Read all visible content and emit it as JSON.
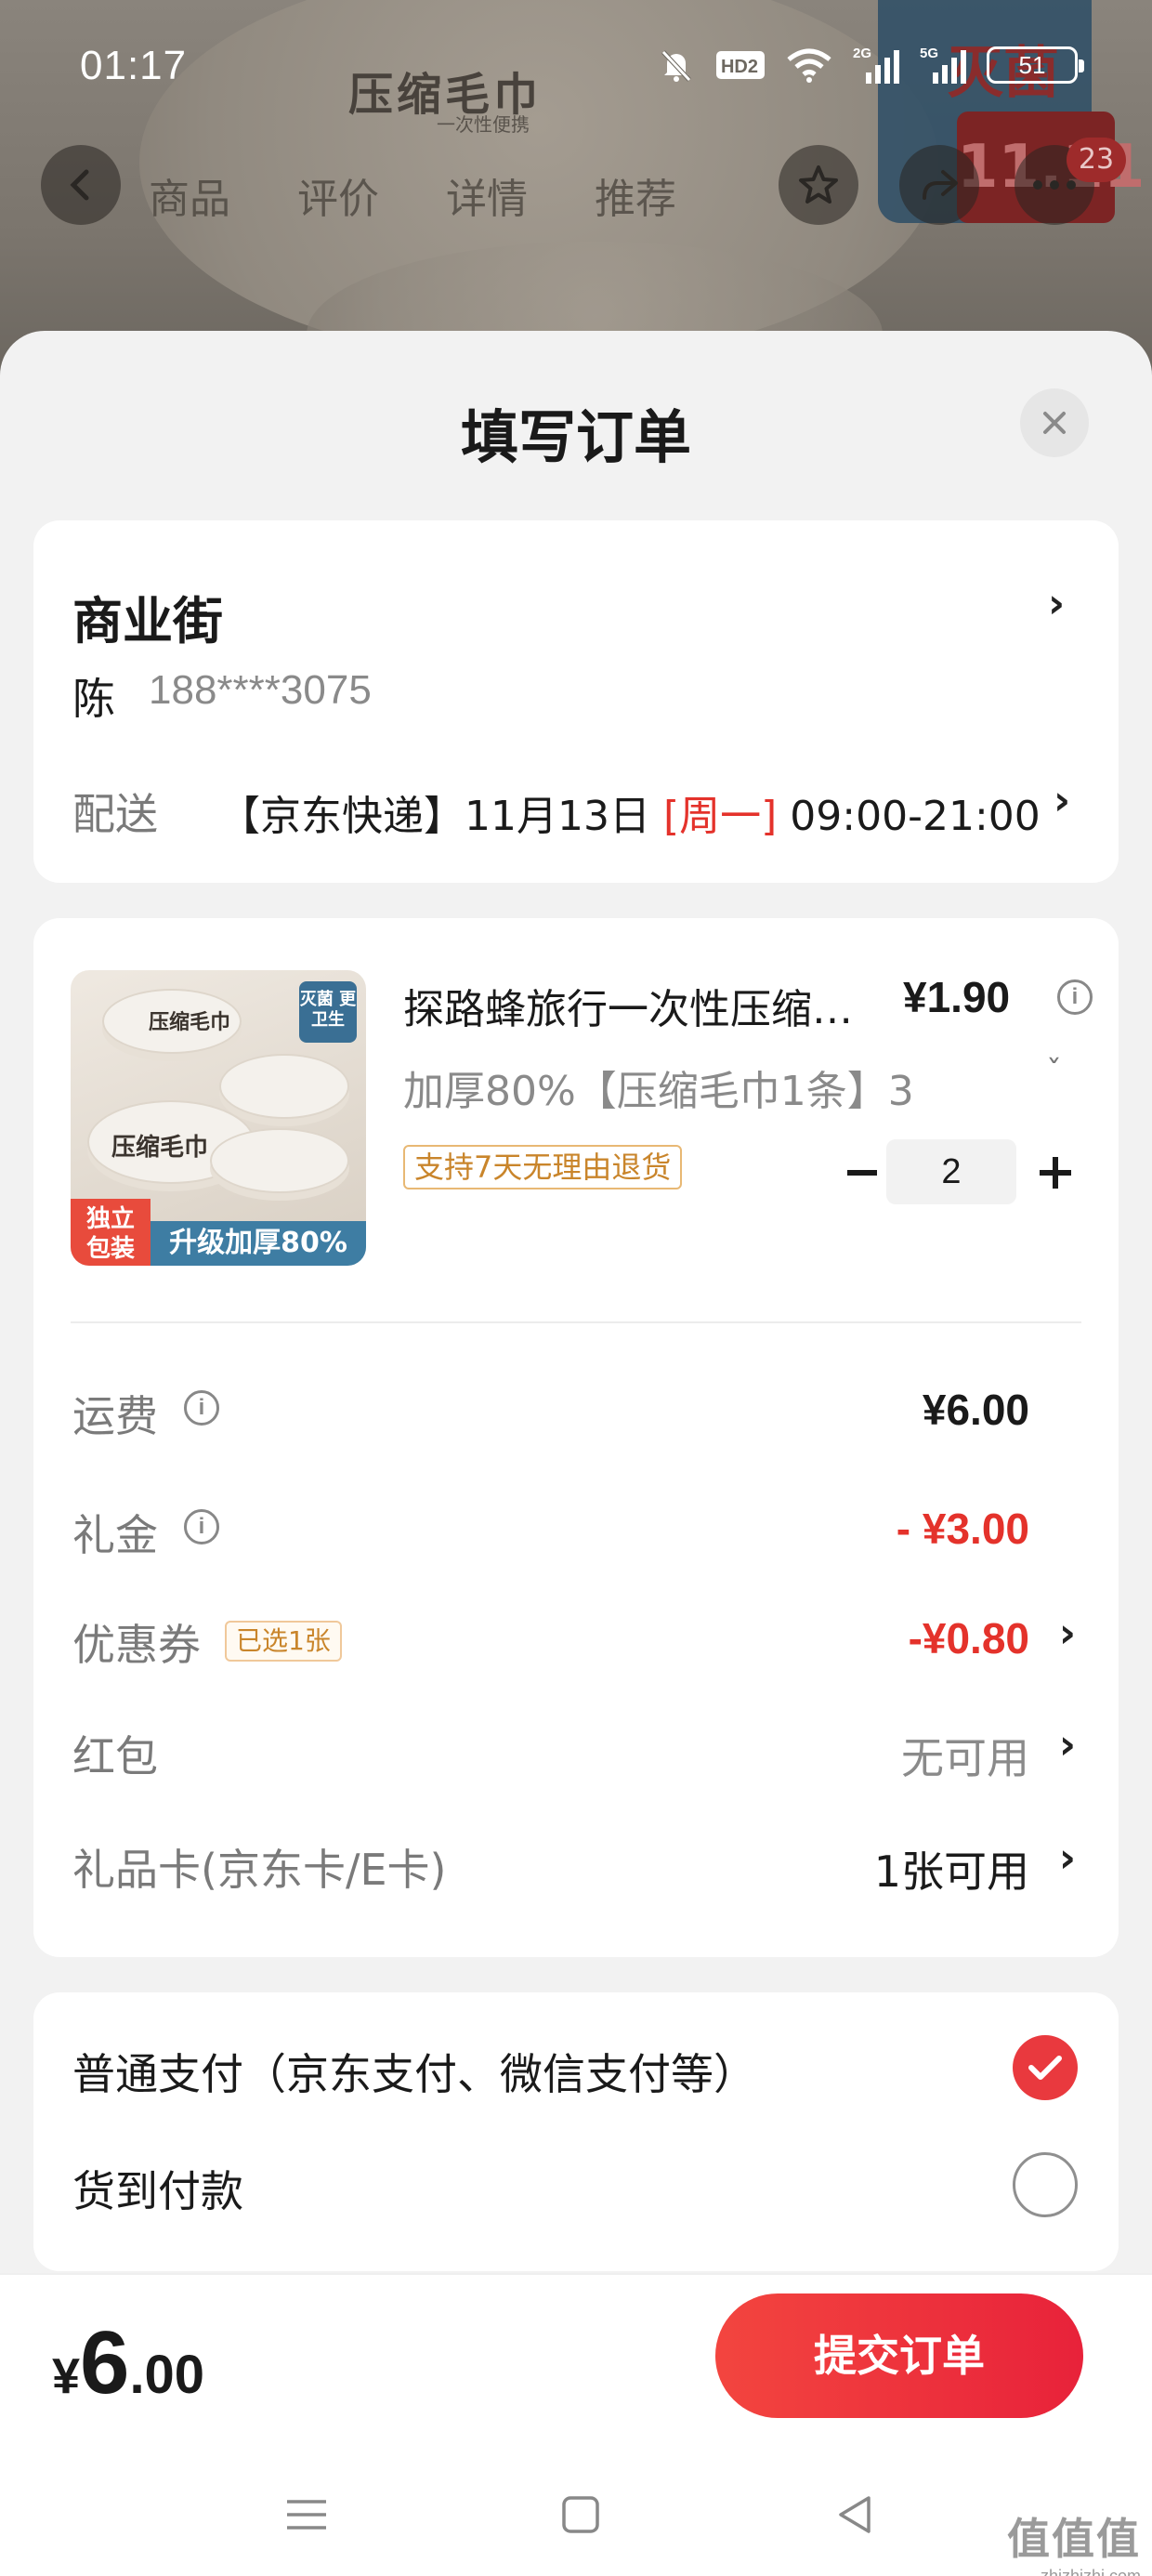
{
  "status_bar": {
    "time": "01:17",
    "network_hd": "HD2",
    "signal_2g": "2G",
    "signal_5g": "5G",
    "battery": "51"
  },
  "background": {
    "product_title": "压缩毛巾",
    "product_subtitle": "一次性便携",
    "badge_text": "灭菌",
    "sale_text": "11.11",
    "cart_count": "23",
    "tabs": [
      "商品",
      "评价",
      "详情",
      "推荐"
    ]
  },
  "sheet": {
    "title": "填写订单"
  },
  "address": {
    "street": "商业街",
    "name": "陈",
    "phone": "188****3075",
    "delivery_label": "配送",
    "delivery_prefix": "【京东快递】11月13日 ",
    "delivery_weekday": "[周一]",
    "delivery_time": " 09:00-21:00"
  },
  "product": {
    "title": "探路蜂旅行一次性压缩毛巾",
    "price": "¥1.90",
    "spec": "加厚80%【压缩毛巾1条】3",
    "return_tag": "支持7天无理由退货",
    "quantity": "2",
    "image": {
      "badge_tr": "灭菌 更卫生",
      "badge_bl": "独立 包装",
      "strip": "升级加厚80%",
      "label": "压缩毛巾"
    }
  },
  "fees": {
    "shipping_label": "运费",
    "shipping_value": "¥6.00",
    "gift_label": "礼金",
    "gift_value": "- ¥3.00",
    "coupon_label": "优惠券",
    "coupon_tag": "已选1张",
    "coupon_value": "-¥0.80",
    "redpacket_label": "红包",
    "redpacket_value": "无可用",
    "giftcard_label": "礼品卡(京东卡/E卡)",
    "giftcard_value": "1张可用"
  },
  "payment": {
    "normal_label": "普通支付（京东支付、微信支付等）",
    "normal_selected": true,
    "cod_label": "货到付款",
    "cod_selected": false
  },
  "footer": {
    "currency": "¥",
    "total_int": "6",
    "total_dec": ".00",
    "submit_label": "提交订单"
  },
  "watermark": {
    "main": "值值值",
    "sub": "zhizhizhi.com"
  },
  "colors": {
    "accent_red": "#e4322b",
    "submit_red": "#f3453f",
    "tag_orange": "#c9852b"
  }
}
